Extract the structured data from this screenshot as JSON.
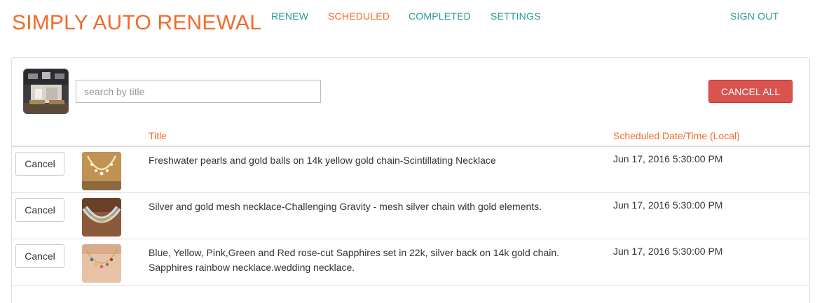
{
  "brand": "SIMPLY AUTO RENEWAL",
  "nav": {
    "renew": "RENEW",
    "scheduled": "SCHEDULED",
    "completed": "COMPLETED",
    "settings": "SETTINGS",
    "sign_out": "SIGN OUT"
  },
  "toolbar": {
    "search_placeholder": "search by title",
    "cancel_all_label": "CANCEL ALL"
  },
  "table": {
    "col_title": "Title",
    "col_date": "Scheduled Date/Time (Local)",
    "rows": [
      {
        "cancel_label": "Cancel",
        "title": "Freshwater pearls and gold balls on 14k yellow gold chain-Scintillating Necklace",
        "date": "Jun 17, 2016 5:30:00 PM"
      },
      {
        "cancel_label": "Cancel",
        "title": "Silver and gold mesh necklace-Challenging Gravity - mesh silver chain with gold elements.",
        "date": "Jun 17, 2016 5:30:00 PM"
      },
      {
        "cancel_label": "Cancel",
        "title": "Blue, Yellow, Pink,Green and Red rose-cut Sapphires set in 22k, silver back on 14k gold chain. Sapphires rainbow necklace.wedding necklace.",
        "date": "Jun 17, 2016 5:30:00 PM"
      }
    ]
  },
  "colors": {
    "accent_orange": "#f26b2a",
    "nav_teal": "#2a9a9a",
    "danger_red": "#d9534f"
  }
}
